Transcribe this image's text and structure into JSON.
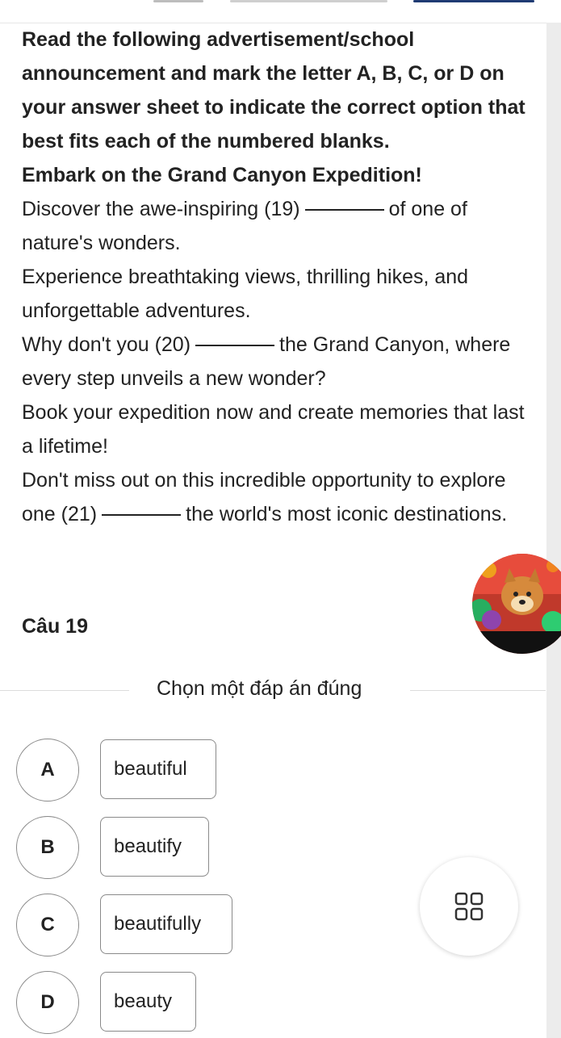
{
  "instructions": "Read the following advertisement/school announcement and mark the letter A, B, C, or D on your answer sheet to indicate the correct option that best fits each of the numbered blanks.",
  "passage": {
    "title": "Embark on the Grand Canyon Expedition!",
    "line1_before": "Discover the awe-inspiring (19)",
    "line1_after": "of one of nature's wonders.",
    "line2": "Experience breathtaking views, thrilling hikes, and unforgettable adventures.",
    "line3_before": "Why don't you (20)",
    "line3_after": "the Grand Canyon, where every step unveils a new wonder?",
    "line4": "Book your expedition now and create memories that last a lifetime!",
    "line5_before": "Don't miss out on this incredible opportunity to explore one (21)",
    "line5_after": "the world's most iconic destinations."
  },
  "question": {
    "label": "Câu 19",
    "prompt": "Chọn một đáp án đúng"
  },
  "options": [
    {
      "letter": "A",
      "text": "beautiful"
    },
    {
      "letter": "B",
      "text": "beautify"
    },
    {
      "letter": "C",
      "text": "beautifully"
    },
    {
      "letter": "D",
      "text": "beauty"
    }
  ],
  "icons": {
    "grid_menu": "grid-icon",
    "avatar": "avatar-image"
  }
}
